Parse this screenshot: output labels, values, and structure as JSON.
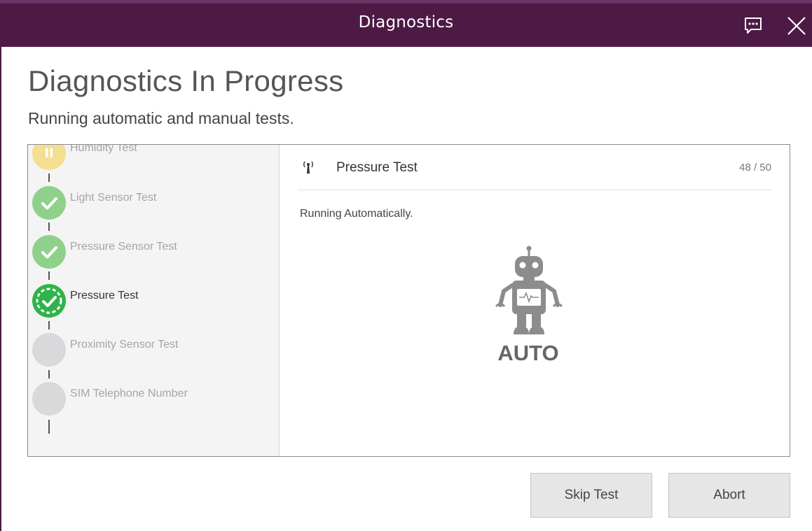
{
  "window": {
    "title": "Diagnostics",
    "accent_color": "#4d1a46",
    "buttons": [
      {
        "icon": "feedback-icon"
      },
      {
        "icon": "close-icon"
      }
    ]
  },
  "header": {
    "title": "Diagnostics In Progress",
    "subtitle": "Running automatic and manual tests."
  },
  "steps": [
    {
      "label": "Humidity Test",
      "status": "paused",
      "color": "#f3df8f",
      "icon": "pause-icon"
    },
    {
      "label": "Light Sensor Test",
      "status": "passed",
      "color": "#8fd18b",
      "icon": "check-icon"
    },
    {
      "label": "Pressure Sensor Test",
      "status": "passed",
      "color": "#8fd18b",
      "icon": "check-icon"
    },
    {
      "label": "Pressure Test",
      "status": "running",
      "color": "#2fb34a",
      "icon": "running-check-icon"
    },
    {
      "label": "Proximity Sensor Test",
      "status": "pending",
      "color": "#d9d9db",
      "icon": ""
    },
    {
      "label": "SIM Telephone Number",
      "status": "pending",
      "color": "#d9d9db",
      "icon": ""
    }
  ],
  "current_test": {
    "icon": "antenna-icon",
    "name": "Pressure Test",
    "counter": "48 / 50",
    "status": "Running Automatically.",
    "mode_icon": "robot-icon",
    "mode_label": "AUTO"
  },
  "actions": {
    "skip_label": "Skip Test",
    "abort_label": "Abort"
  }
}
